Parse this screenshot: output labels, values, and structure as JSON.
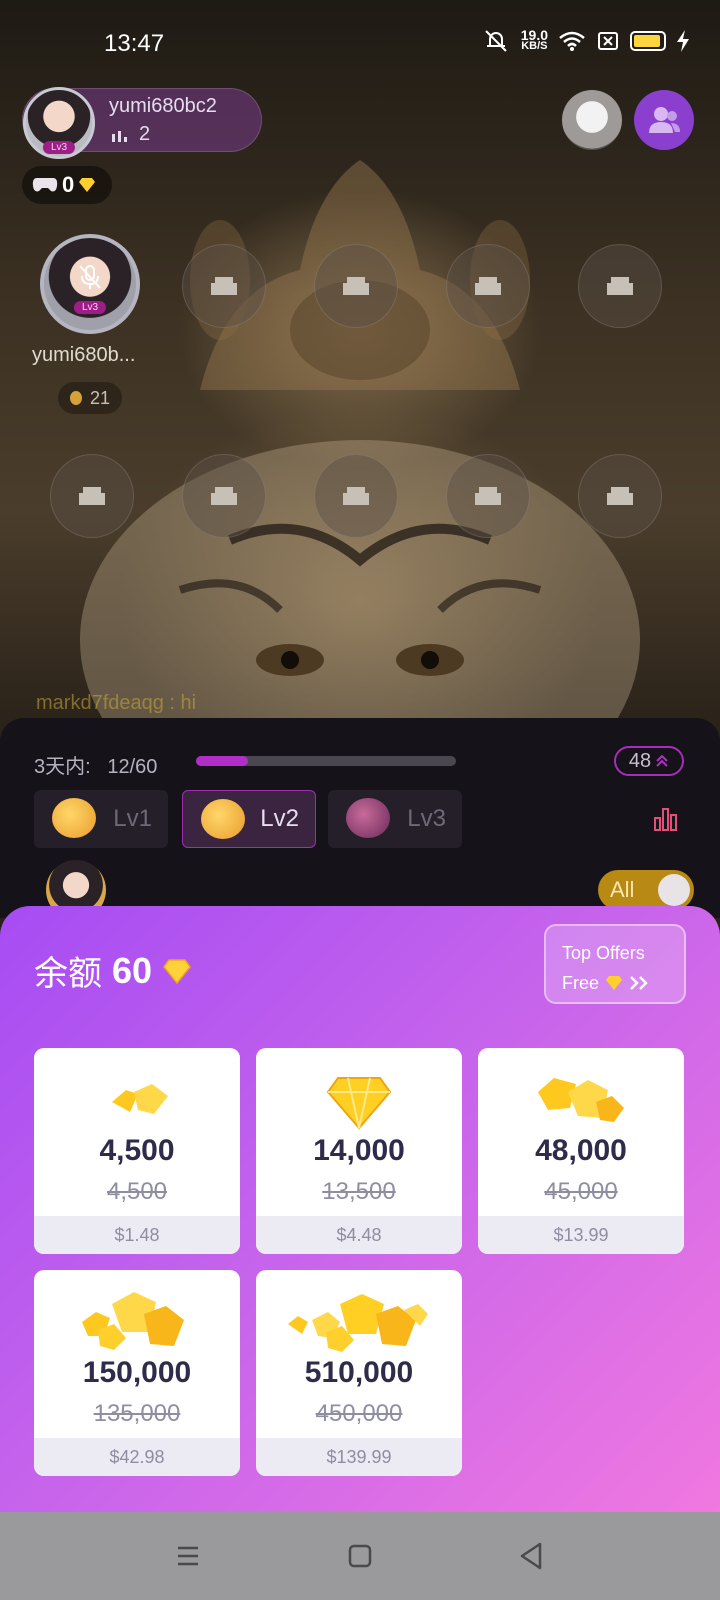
{
  "status_bar": {
    "time": "13:47",
    "net_speed_value": "19.0",
    "net_speed_unit": "KB/S"
  },
  "host": {
    "name": "yumi680bc2",
    "level": "Lv3",
    "listeners": "2",
    "gems": "0"
  },
  "seat_host": {
    "name": "yumi680b...",
    "level": "Lv3",
    "coins": "21"
  },
  "chat": {
    "user": "markd7fdeaqg",
    "message": " : hi"
  },
  "gift_panel": {
    "days_label": "3天内:",
    "progress_text": "12/60",
    "progress_fraction": 0.2,
    "level_pill": "48",
    "tabs": [
      {
        "label": "Lv1",
        "active": false
      },
      {
        "label": "Lv2",
        "active": true
      },
      {
        "label": "Lv3",
        "active": false
      }
    ],
    "toggle_label": "All"
  },
  "recharge": {
    "balance_label": "余额",
    "balance_amount": "60",
    "top_offers_line1": "Top Offers",
    "top_offers_line2": "Free",
    "packages": [
      {
        "amount": "4,500",
        "original": "4,500",
        "price": "$1.48"
      },
      {
        "amount": "14,000",
        "original": "13,500",
        "price": "$4.48"
      },
      {
        "amount": "48,000",
        "original": "45,000",
        "price": "$13.99"
      },
      {
        "amount": "150,000",
        "original": "135,000",
        "price": "$42.98"
      },
      {
        "amount": "510,000",
        "original": "450,000",
        "price": "$139.99"
      }
    ]
  },
  "colors": {
    "accent_purple": "#a64cf3",
    "accent_pink": "#f078e0",
    "gem_yellow": "#ffd53f",
    "progress": "#b22fc7"
  }
}
